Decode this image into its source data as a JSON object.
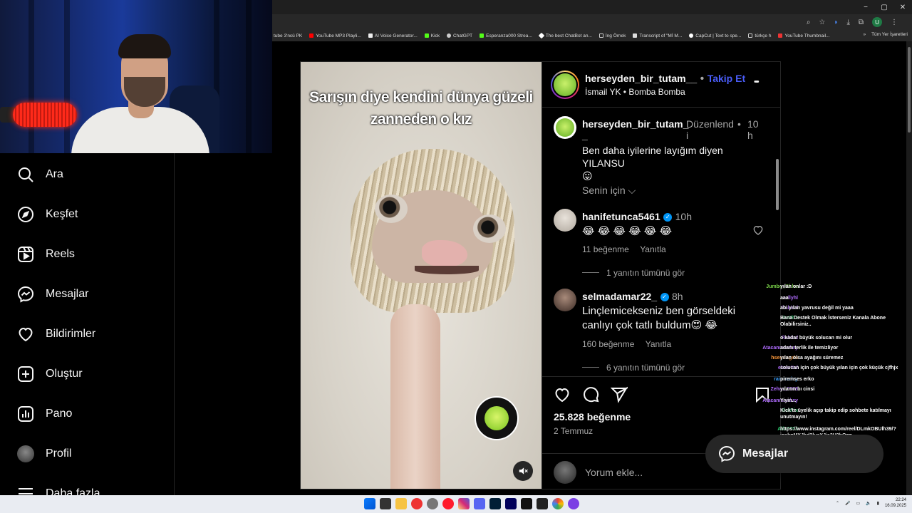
{
  "browser": {
    "window_controls": [
      "−",
      "▢",
      "✕"
    ],
    "bookmarks": [
      "tube 3'ncü PK",
      "YouTube MP3 Playli...",
      "AI Voice Generator...",
      "Kick",
      "ChatGPT",
      "Esperanza000 Strea...",
      "The best ChatBot an...",
      "İng Örnek",
      "Transcript of \"Mİ M...",
      "CapCut | Text to spe...",
      "türkçe h",
      "YouTube Thumbnail..."
    ],
    "bookmarks_more": "»",
    "bookmarks_all": "Tüm Yer İşaretleri",
    "profile_initial": "U"
  },
  "nav": {
    "items": [
      {
        "label": "Ara",
        "icon": "search-icon"
      },
      {
        "label": "Keşfet",
        "icon": "compass-icon"
      },
      {
        "label": "Reels",
        "icon": "reels-icon"
      },
      {
        "label": "Mesajlar",
        "icon": "messenger-icon"
      },
      {
        "label": "Bildirimler",
        "icon": "heart-icon"
      },
      {
        "label": "Oluştur",
        "icon": "plus-square-icon"
      },
      {
        "label": "Pano",
        "icon": "dashboard-icon"
      },
      {
        "label": "Profil",
        "icon": "avatar"
      },
      {
        "label": "Daha fazla",
        "icon": "menu-icon"
      }
    ]
  },
  "post": {
    "media_caption_line1": "Sarışın diye kendini dünya güzeli",
    "media_caption_line2": "zanneden o kız",
    "header": {
      "username": "herseyden_bir_tutam__",
      "dot": "•",
      "follow": "Takip Et",
      "subtitle": "İsmail YK • Bomba Bomba",
      "more": "•••"
    },
    "caption": {
      "username_line1": "herseyden_bir_tutam_",
      "username_line2": "_",
      "edited_line1": "Düzenlend",
      "edited_line2": "i",
      "dot": "•",
      "time_line1": "10",
      "time_line2": "h",
      "text": "Ben daha iyilerine layığım diyen YILANSU",
      "emoji": "😛",
      "translation": "Senin için ⌵"
    },
    "comments": [
      {
        "username": "hanifetunca5461",
        "time": "10h",
        "text": "😂 😂 😂 😂 😂 😂",
        "likes": "11 beğenme",
        "reply": "Yanıtla",
        "view_replies": "1 yanıtın tümünü gör"
      },
      {
        "username": "selmadamar22_",
        "time": "8h",
        "text_line1": "Linçlemicekseniz ben görseldeki",
        "text_line2": "canlıyı çok tatlı buldum😍 😂",
        "likes": "160 beğenme",
        "reply": "Yanıtla",
        "view_replies": "6 yanıtın tümünü gör"
      }
    ],
    "likes": "25.828 beğenme",
    "date": "2 Temmuz",
    "comment_placeholder": "Yorum ekle..."
  },
  "chat": {
    "messages": [
      {
        "user": "Jumbo_Gkhn",
        "color": "#7bd44a",
        "text": "yılan onlar :D"
      },
      {
        "user": "sellyhl",
        "color": "#b06cff",
        "text": "aaa"
      },
      {
        "user": "Rabisd",
        "color": "#b06cff",
        "text": "abi yılan yavrusu değil mi yaaa"
      },
      {
        "user": "BotRix",
        "color": "#2ecc71",
        "text": "Bana Destek Olmak İsterseniz Kanala Abone Olabilirsiniz.."
      },
      {
        "user": "Rabisd",
        "color": "#b06cff",
        "text": "o kadar büyük solucan mi olur"
      },
      {
        "user": "Atacanmonkey",
        "color": "#b06cff",
        "text": "adam terlik ile temizliyor"
      },
      {
        "user": "hsendogdu",
        "color": "#ff9a3c",
        "text": "yılan olsa ayağını süremez"
      },
      {
        "user": "elanvital",
        "color": "#b06cff",
        "text": "solucan için çok büyük yılan için çok küçük cjfhjx"
      },
      {
        "user": "rainnrainy",
        "color": "#3aa0ff",
        "text": "piremses erko"
      },
      {
        "user": "Zehra_2308",
        "color": "#b06cff",
        "text": "yılanın bı cinsi"
      },
      {
        "user": "Atacanmonkey",
        "color": "#b06cff",
        "text": "Yiyin..."
      },
      {
        "user": "BotRix",
        "color": "#2ecc71",
        "text": "Kick'te üyelik açıp takip edip sohbete katılmayı unutmayın!"
      },
      {
        "user": "Alfa3302",
        "color": "#2ecc71",
        "text": "https://www.instagram.com/reel/DLmkOBUlh39/?igsh=MXJhd2lueXJja3U2bQ=="
      }
    ]
  },
  "messages_button": "Mesajlar",
  "taskbar": {
    "time": "22:24",
    "date": "16.09.2025"
  }
}
